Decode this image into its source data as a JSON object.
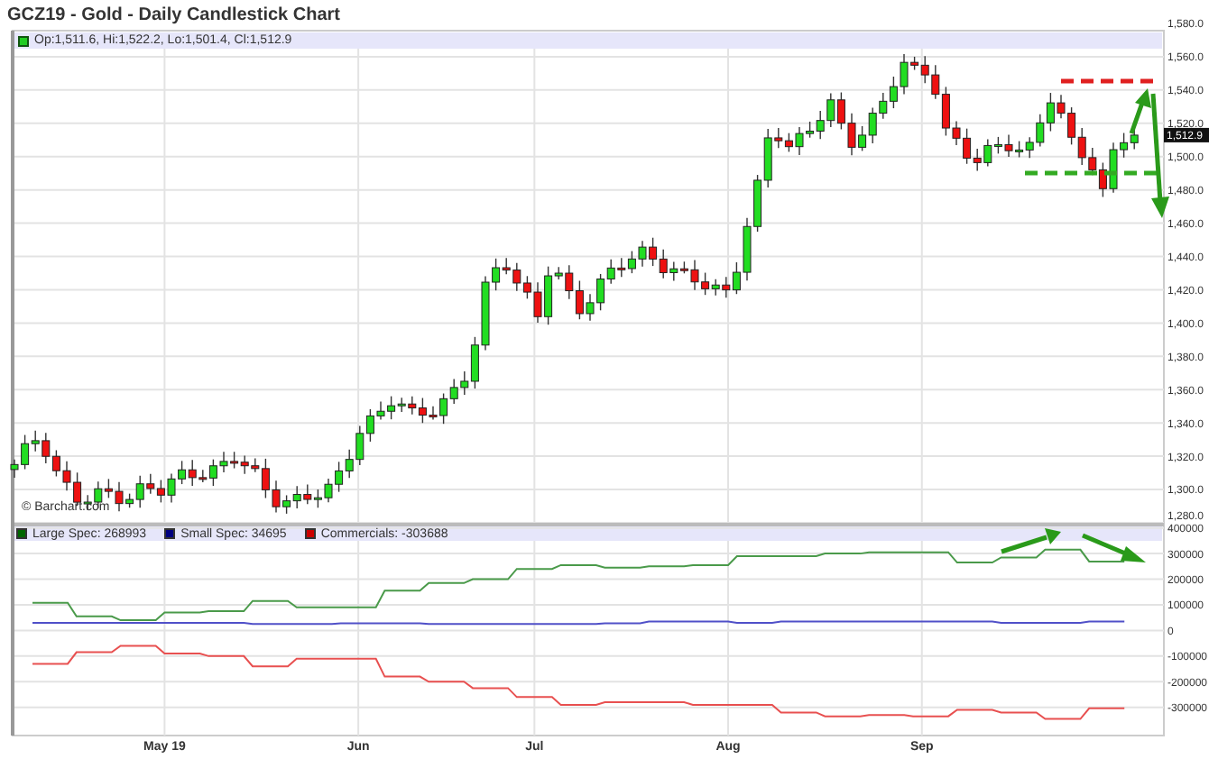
{
  "title": "GCZ19 - Gold - Daily Candlestick Chart",
  "price_panel": {
    "ohlc": "Op:1,511.6, Hi:1,522.2, Lo:1,501.4, Cl:1,512.9",
    "credit": "© Barchart.com",
    "last_price": "1,512.9",
    "y_axis_labels": [
      "1,580.0",
      "1,560.0",
      "1,540.0",
      "1,520.0",
      "1,500.0",
      "1,480.0",
      "1,460.0",
      "1,440.0",
      "1,420.0",
      "1,400.0",
      "1,380.0",
      "1,360.0",
      "1,340.0",
      "1,320.0",
      "1,300.0",
      "1,280.0"
    ]
  },
  "cot_panel": {
    "legend": [
      {
        "reading": ": 268993",
        "color": "#006600"
      },
      {
        "reading": ": 34695",
        "color": "#000080"
      },
      {
        "reading": ": -303688",
        "color": "#cc0000"
      }
    ],
    "chart_data": {
      "type": "line",
      "categories": [
        null,
        null,
        null,
        null,
        null,
        null,
        null,
        null,
        null,
        null,
        null,
        null,
        null,
        null,
        null,
        "May 19",
        null,
        null,
        null,
        null,
        null,
        null,
        null,
        null,
        null,
        null,
        null,
        null,
        null,
        null,
        null,
        null,
        null,
        null,
        null,
        null,
        null,
        "Jun",
        null,
        null,
        null,
        null,
        null,
        null,
        null,
        null,
        null,
        null,
        null,
        null,
        null,
        null,
        null,
        null,
        null,
        null,
        null,
        "Jul",
        null,
        null,
        null,
        null,
        null,
        null,
        null,
        null,
        null,
        null,
        null,
        null,
        null,
        null,
        null,
        null,
        null,
        null,
        null,
        null,
        null,
        "Aug",
        null,
        null,
        null,
        null,
        null,
        null,
        null,
        null,
        null,
        null,
        null,
        null,
        null,
        null,
        null,
        null,
        null,
        null,
        null,
        null,
        null,
        "Sep",
        null,
        null,
        null,
        null,
        null,
        null,
        null,
        null,
        null,
        null,
        null,
        null,
        null,
        null,
        null,
        null,
        null,
        null,
        null,
        null,
        null,
        null,
        null
      ],
      "series": [
        {
          "name": "Large Spec",
          "color": "#4a9a4a",
          "values": [
            108000,
            108000,
            108000,
            108000,
            108000,
            55000,
            55000,
            55000,
            55000,
            55000,
            40000,
            40000,
            40000,
            40000,
            40000,
            70000,
            70000,
            70000,
            70000,
            70000,
            75000,
            75000,
            75000,
            75000,
            75000,
            115000,
            115000,
            115000,
            115000,
            115000,
            90000,
            90000,
            90000,
            90000,
            90000,
            90000,
            90000,
            90000,
            90000,
            90000,
            155000,
            155000,
            155000,
            155000,
            155000,
            185000,
            185000,
            185000,
            185000,
            185000,
            200000,
            200000,
            200000,
            200000,
            200000,
            240000,
            240000,
            240000,
            240000,
            240000,
            255000,
            255000,
            255000,
            255000,
            255000,
            245000,
            245000,
            245000,
            245000,
            245000,
            250000,
            250000,
            250000,
            250000,
            250000,
            255000,
            255000,
            255000,
            255000,
            255000,
            290000,
            290000,
            290000,
            290000,
            290000,
            290000,
            290000,
            290000,
            290000,
            290000,
            300000,
            300000,
            300000,
            300000,
            300000,
            305000,
            305000,
            305000,
            305000,
            305000,
            305000,
            305000,
            305000,
            305000,
            305000,
            265000,
            265000,
            265000,
            265000,
            265000,
            285000,
            285000,
            285000,
            285000,
            285000,
            315000,
            315000,
            315000,
            315000,
            315000,
            269000,
            269000,
            269000,
            269000,
            269000
          ]
        },
        {
          "name": "Small Spec",
          "color": "#5050c8",
          "values": [
            30000,
            30000,
            30000,
            30000,
            30000,
            30000,
            30000,
            30000,
            30000,
            30000,
            30000,
            30000,
            30000,
            30000,
            30000,
            30000,
            30000,
            30000,
            30000,
            30000,
            30000,
            30000,
            30000,
            30000,
            30000,
            25000,
            25000,
            25000,
            25000,
            25000,
            25000,
            25000,
            25000,
            25000,
            25000,
            28000,
            28000,
            28000,
            28000,
            28000,
            28000,
            28000,
            28000,
            28000,
            28000,
            25000,
            25000,
            25000,
            25000,
            25000,
            25000,
            25000,
            25000,
            25000,
            25000,
            25000,
            25000,
            25000,
            25000,
            25000,
            25000,
            25000,
            25000,
            25000,
            25000,
            28000,
            28000,
            28000,
            28000,
            28000,
            35000,
            35000,
            35000,
            35000,
            35000,
            35000,
            35000,
            35000,
            35000,
            35000,
            30000,
            30000,
            30000,
            30000,
            30000,
            35000,
            35000,
            35000,
            35000,
            35000,
            35000,
            35000,
            35000,
            35000,
            35000,
            35000,
            35000,
            35000,
            35000,
            35000,
            35000,
            35000,
            35000,
            35000,
            35000,
            35000,
            35000,
            35000,
            35000,
            35000,
            30000,
            30000,
            30000,
            30000,
            30000,
            30000,
            30000,
            30000,
            30000,
            30000,
            35000,
            35000,
            35000,
            35000,
            35000
          ]
        },
        {
          "name": "Commercials",
          "color": "#e85050",
          "values": [
            -130000,
            -130000,
            -130000,
            -130000,
            -130000,
            -85000,
            -85000,
            -85000,
            -85000,
            -85000,
            -60000,
            -60000,
            -60000,
            -60000,
            -60000,
            -90000,
            -90000,
            -90000,
            -90000,
            -90000,
            -100000,
            -100000,
            -100000,
            -100000,
            -100000,
            -140000,
            -140000,
            -140000,
            -140000,
            -140000,
            -110000,
            -110000,
            -110000,
            -110000,
            -110000,
            -110000,
            -110000,
            -110000,
            -110000,
            -110000,
            -180000,
            -180000,
            -180000,
            -180000,
            -180000,
            -200000,
            -200000,
            -200000,
            -200000,
            -200000,
            -225000,
            -225000,
            -225000,
            -225000,
            -225000,
            -260000,
            -260000,
            -260000,
            -260000,
            -260000,
            -290000,
            -290000,
            -290000,
            -290000,
            -290000,
            -280000,
            -280000,
            -280000,
            -280000,
            -280000,
            -280000,
            -280000,
            -280000,
            -280000,
            -280000,
            -290000,
            -290000,
            -290000,
            -290000,
            -290000,
            -290000,
            -290000,
            -290000,
            -290000,
            -290000,
            -320000,
            -320000,
            -320000,
            -320000,
            -320000,
            -335000,
            -335000,
            -335000,
            -335000,
            -335000,
            -330000,
            -330000,
            -330000,
            -330000,
            -330000,
            -335000,
            -335000,
            -335000,
            -335000,
            -335000,
            -310000,
            -310000,
            -310000,
            -310000,
            -310000,
            -320000,
            -320000,
            -320000,
            -320000,
            -320000,
            -345000,
            -345000,
            -345000,
            -345000,
            -345000,
            -304000,
            -304000,
            -304000,
            -304000,
            -304000
          ]
        }
      ],
      "grid": true,
      "ylim": [
        -410000,
        420000
      ],
      "yticks": [
        {
          "value": 400000,
          "label": "400000"
        },
        {
          "value": 300000,
          "label": "300000"
        },
        {
          "value": 200000,
          "label": "200000"
        },
        {
          "value": 100000,
          "label": "100000"
        },
        {
          "value": 0,
          "label": "0"
        },
        {
          "value": -100000,
          "label": "-100000"
        },
        {
          "value": -200000,
          "label": "-200000"
        },
        {
          "value": -300000,
          "label": "-300000"
        }
      ]
    }
  }
}
